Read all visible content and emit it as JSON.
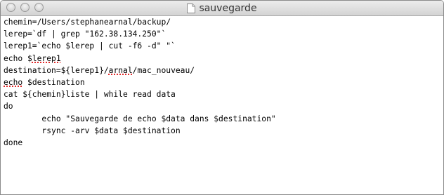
{
  "window": {
    "title": "sauvegarde"
  },
  "icons": {
    "close": "close-button",
    "minimize": "minimize-button",
    "zoom": "zoom-button",
    "document": "document-icon"
  },
  "editor": {
    "lines": [
      {
        "parts": [
          {
            "text": "chemin=/Users/stephanearnal/backup/"
          }
        ]
      },
      {
        "parts": [
          {
            "text": "lerep=`df | grep \"162.38.134.250\"`"
          }
        ]
      },
      {
        "parts": [
          {
            "text": "lerep1=`echo $lerep | cut -f6 -d\" \"`"
          }
        ]
      },
      {
        "parts": [
          {
            "text": "echo $"
          },
          {
            "text": "lerep1",
            "misspelled": true
          }
        ]
      },
      {
        "parts": [
          {
            "text": "destination=${lerep1}/"
          },
          {
            "text": "arnal",
            "misspelled": true
          },
          {
            "text": "/mac_nouveau/"
          }
        ]
      },
      {
        "parts": [
          {
            "text": "echo",
            "misspelled": true
          },
          {
            "text": " $destination"
          }
        ]
      },
      {
        "parts": [
          {
            "text": "cat ${chemin}liste | while read data"
          }
        ]
      },
      {
        "parts": [
          {
            "text": "do"
          }
        ]
      },
      {
        "parts": [
          {
            "text": "        echo \"Sauvegarde de echo $data dans $destination\""
          }
        ]
      },
      {
        "parts": [
          {
            "text": "        rsync -arv $data $destination"
          }
        ]
      },
      {
        "parts": [
          {
            "text": "done"
          }
        ]
      }
    ]
  }
}
